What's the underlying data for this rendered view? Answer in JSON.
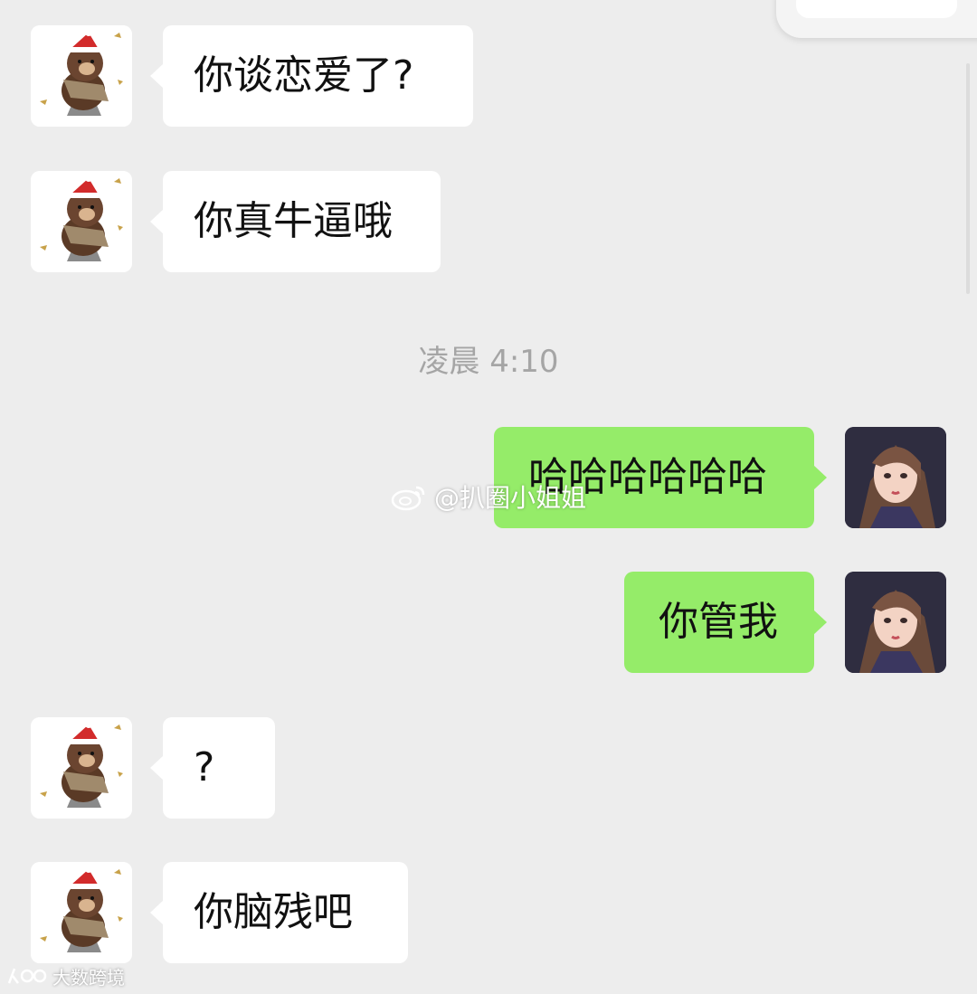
{
  "chat": {
    "messages": [
      {
        "side": "left",
        "text": "你谈恋爱了?"
      },
      {
        "side": "left",
        "text": "你真牛逼哦"
      },
      {
        "side": "right",
        "text": "哈哈哈哈哈哈"
      },
      {
        "side": "right",
        "text": "你管我"
      },
      {
        "side": "left",
        "text": "?"
      },
      {
        "side": "left",
        "text": "你脑残吧"
      }
    ],
    "timestamp": "凌晨 4:10"
  },
  "avatars": {
    "left_icon": "brown-bear-santa-hat-avatar",
    "right_icon": "anime-girl-avatar"
  },
  "watermarks": {
    "weibo_handle": "@扒圈小姐姐",
    "bottom_brand": "大数跨境"
  },
  "colors": {
    "background": "#ededed",
    "incoming_bubble": "#ffffff",
    "outgoing_bubble": "#95ec69",
    "timestamp_text": "#a5a5a5"
  }
}
